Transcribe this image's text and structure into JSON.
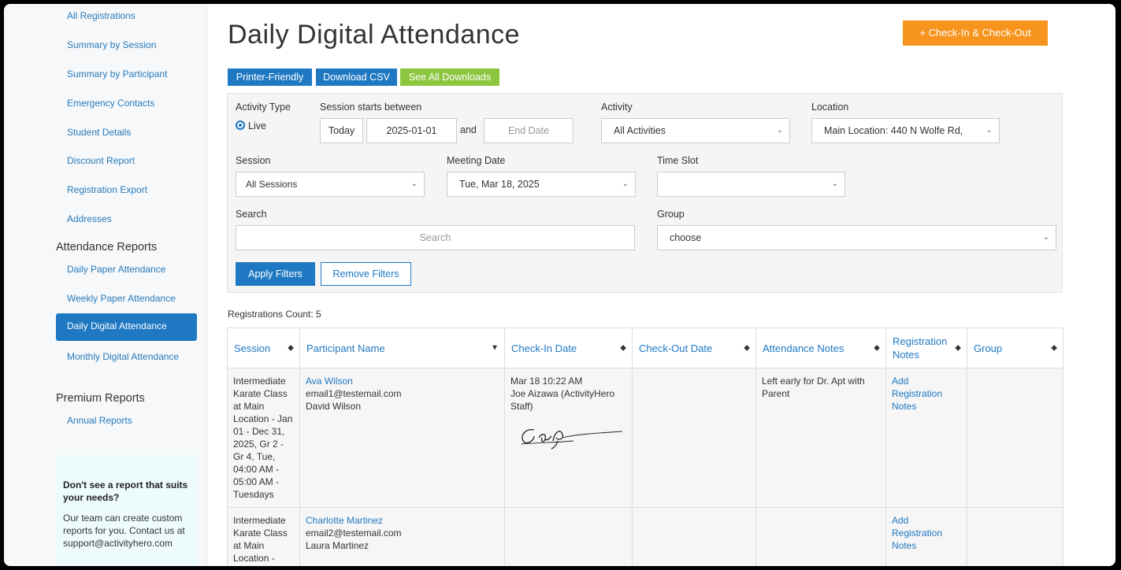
{
  "sidebar": {
    "report_links": [
      "All Registrations",
      "Summary by Session",
      "Summary by Participant",
      "Emergency Contacts",
      "Student Details",
      "Discount Report",
      "Registration Export",
      "Addresses"
    ],
    "attendance_heading": "Attendance Reports",
    "attendance_links": [
      "Daily Paper Attendance",
      "Weekly Paper Attendance",
      "Daily Digital Attendance",
      "Monthly Digital Attendance"
    ],
    "premium_heading": "Premium Reports",
    "premium_links": [
      "Annual Reports"
    ],
    "help_title": "Don't see a report that suits your needs?",
    "help_body": "Our team can create custom reports for you. Contact us at support@activityhero.com"
  },
  "header": {
    "title": "Daily Digital Attendance",
    "checkin_button": "+ Check-In & Check-Out",
    "printer_button": "Printer-Friendly",
    "csv_button": "Download CSV",
    "downloads_button": "See All Downloads"
  },
  "filters": {
    "activity_type_label": "Activity Type",
    "activity_type_value": "Live",
    "session_starts_label": "Session starts between",
    "today_button": "Today",
    "start_date": "2025-01-01",
    "and_text": "and",
    "end_date_placeholder": "End Date",
    "activity_label": "Activity",
    "activity_value": "All Activities",
    "location_label": "Location",
    "location_value": "Main Location: 440 N Wolfe Rd,",
    "session_label": "Session",
    "session_value": "All Sessions",
    "meeting_date_label": "Meeting Date",
    "meeting_date_value": "Tue, Mar 18, 2025",
    "time_slot_label": "Time Slot",
    "time_slot_value": "",
    "search_label": "Search",
    "search_placeholder": "Search",
    "group_label": "Group",
    "group_value": "choose",
    "apply_button": "Apply Filters",
    "remove_button": "Remove Filters"
  },
  "registrations_count": "Registrations Count: 5",
  "table": {
    "headers": [
      "Session",
      "Participant Name",
      "Check-In Date",
      "Check-Out Date",
      "Attendance Notes",
      "Registration Notes",
      "Group"
    ],
    "rows": [
      {
        "session": "Intermediate Karate Class at Main Location - Jan 01 - Dec 31, 2025, Gr 2 - Gr 4, Tue, 04:00 AM - 05:00 AM - Tuesdays",
        "participant_name": "Ava Wilson",
        "participant_email": "email1@testemail.com",
        "participant_parent": "David Wilson",
        "checkin_time": "Mar 18 10:22 AM",
        "checkin_by": "Joe Aizawa (ActivityHero Staff)",
        "checkout": "",
        "attendance_notes": "Left early for Dr. Apt with Parent",
        "registration_notes": "Add Registration Notes",
        "group": ""
      },
      {
        "session": "Intermediate Karate Class at Main Location -",
        "participant_name": "Charlotte Martinez",
        "participant_email": "email2@testemail.com",
        "participant_parent": "Laura Martinez",
        "checkin_time": "",
        "checkin_by": "",
        "checkout": "",
        "attendance_notes": "",
        "registration_notes": "Add Registration Notes",
        "group": ""
      }
    ]
  }
}
